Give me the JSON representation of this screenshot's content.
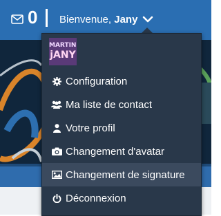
{
  "header": {
    "messages_count": "0",
    "greeting_prefix": "Bienvenue,",
    "username": "Jany"
  },
  "avatar": {
    "line1": "MARTINK",
    "line2": "jANY"
  },
  "menu": {
    "items": [
      {
        "label": "Configuration",
        "icon": "gear-icon"
      },
      {
        "label": "Ma liste de contact",
        "icon": "users-icon"
      },
      {
        "label": "Votre profil",
        "icon": "user-icon"
      },
      {
        "label": "Changement d'avatar",
        "icon": "camera-icon"
      },
      {
        "label": "Changement de signature",
        "icon": "image-icon",
        "active": true
      },
      {
        "label": "Déconnexion",
        "icon": "power-icon"
      }
    ]
  },
  "colors": {
    "topbar": "#2a6eb2",
    "dropdown_bg": "#29384a",
    "active_item_bg": "#3b4a5e"
  }
}
